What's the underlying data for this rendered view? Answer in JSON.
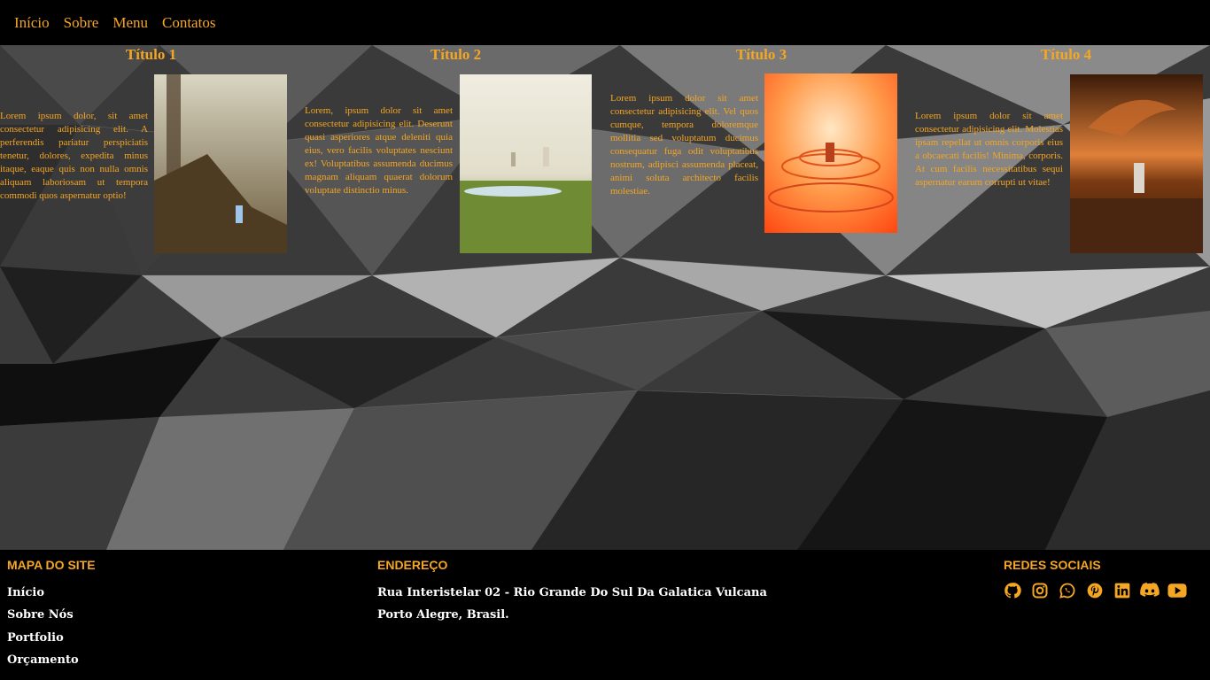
{
  "nav": {
    "items": [
      "Início",
      "Sobre",
      "Menu",
      "Contatos"
    ]
  },
  "cards": [
    {
      "title": "Título 1",
      "text": "Lorem ipsum dolor, sit amet consectetur adipisicing elit. A perferendis pariatur perspiciatis tenetur, dolores, expedita minus itaque, eaque quis non nulla omnis aliquam laboriosam ut tempora commodi quos aspernatur optio!"
    },
    {
      "title": "Título 2",
      "text": "Lorem, ipsum dolor sit amet consectetur adipisicing elit. Deserunt quasi asperiores atque deleniti quia eius, vero facilis voluptates nesciunt ex! Voluptatibus assumenda ducimus magnam aliquam quaerat dolorum voluptate distinctio minus."
    },
    {
      "title": "Título 3",
      "text": "Lorem ipsum dolor sit amet consectetur adipisicing elit. Vel quos cumque, tempora doloremque mollitia sed voluptatum ducimus consequatur fuga odit voluptatibus nostrum, adipisci assumenda placeat, animi soluta architecto facilis molestiae."
    },
    {
      "title": "Título 4",
      "text": "Lorem ipsum dolor sit amet consectetur adipisicing elit. Molestias ipsam repellat ut omnis corporis eius a obcaecati facilis! Minima, corporis. At cum facilis necessitatibus sequi aspernatur earum corrupti ut vitae!"
    }
  ],
  "footer": {
    "sitemap": {
      "heading": "MAPA DO SITE",
      "links": [
        "Início",
        "Sobre Nós",
        "Portfolio",
        "Orçamento"
      ]
    },
    "address": {
      "heading": "ENDEREÇO",
      "line1": "Rua Interistelar 02 - Rio Grande Do Sul Da Galatica Vulcana",
      "line2": "Porto Alegre, Brasil."
    },
    "social": {
      "heading": "REDES SOCIAIS",
      "icons": [
        "github-icon",
        "instagram-icon",
        "whatsapp-icon",
        "pinterest-icon",
        "linkedin-icon",
        "discord-icon",
        "youtube-icon"
      ]
    }
  },
  "colors": {
    "accent": "#f5a623",
    "background": "#000000",
    "footer_text": "#ffffff"
  }
}
